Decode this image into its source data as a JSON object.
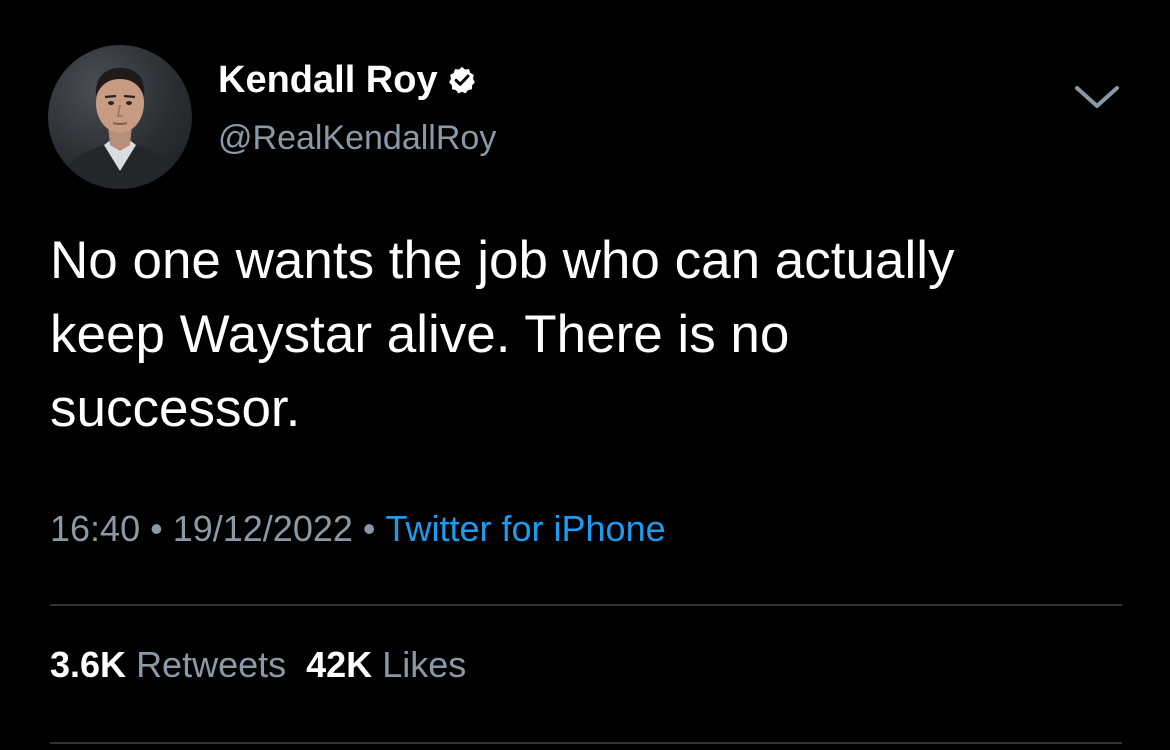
{
  "author": {
    "display_name": "Kendall Roy",
    "handle": "@RealKendallRoy",
    "verified": true
  },
  "tweet": {
    "text": "No one wants the job who can actually\nkeep Waystar alive. There is no\nsuccessor.",
    "time": "16:40",
    "date": "19/12/2022",
    "source": "Twitter for iPhone",
    "separator": "•"
  },
  "stats": {
    "retweets_count": "3.6K",
    "retweets_label": "Retweets",
    "likes_count": "42K",
    "likes_label": "Likes"
  },
  "icons": {
    "verified": "verified-badge-icon",
    "menu": "chevron-down-icon"
  },
  "colors": {
    "background": "#000000",
    "text": "#ffffff",
    "secondary_text": "#8b98a5",
    "link": "#1d9bf0",
    "divider": "#2f3336"
  }
}
